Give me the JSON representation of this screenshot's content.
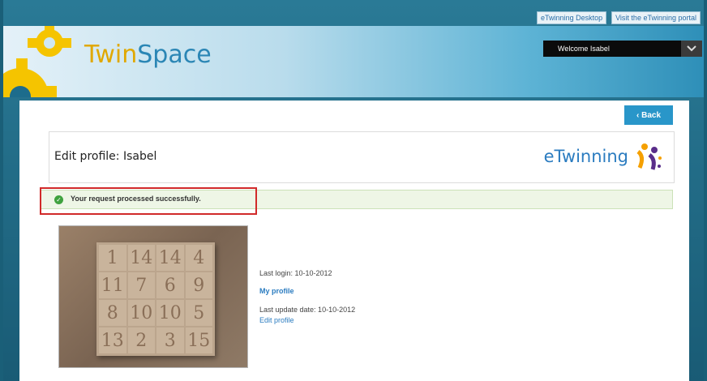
{
  "toplinks": {
    "etwinning_desktop": "eTwinning Desktop",
    "visit_portal": "Visit the eTwinning portal"
  },
  "header": {
    "logo_part1": "Twin",
    "logo_part2": "Space",
    "welcome": "Welcome Isabel",
    "dropdown_icon": "chevron-down-icon"
  },
  "page": {
    "back_label": "‹ Back",
    "title": "Edit profile: Isabel",
    "etwinning_logo": "eTwinning",
    "success_message": "Your request processed successfully.",
    "last_login": "Last login: 10-10-2012",
    "my_profile": "My profile",
    "last_update": "Last update date: 10-10-2012",
    "edit_profile": "Edit profile"
  },
  "photo": {
    "numbers": [
      "1",
      "14",
      "14",
      "4",
      "11",
      "7",
      "6",
      "9",
      "8",
      "10",
      "10",
      "5",
      "13",
      "2",
      "3",
      "15"
    ]
  },
  "colors": {
    "accent": "#2996c9",
    "highlight": "#d12a2a",
    "success": "#3fa23f"
  }
}
